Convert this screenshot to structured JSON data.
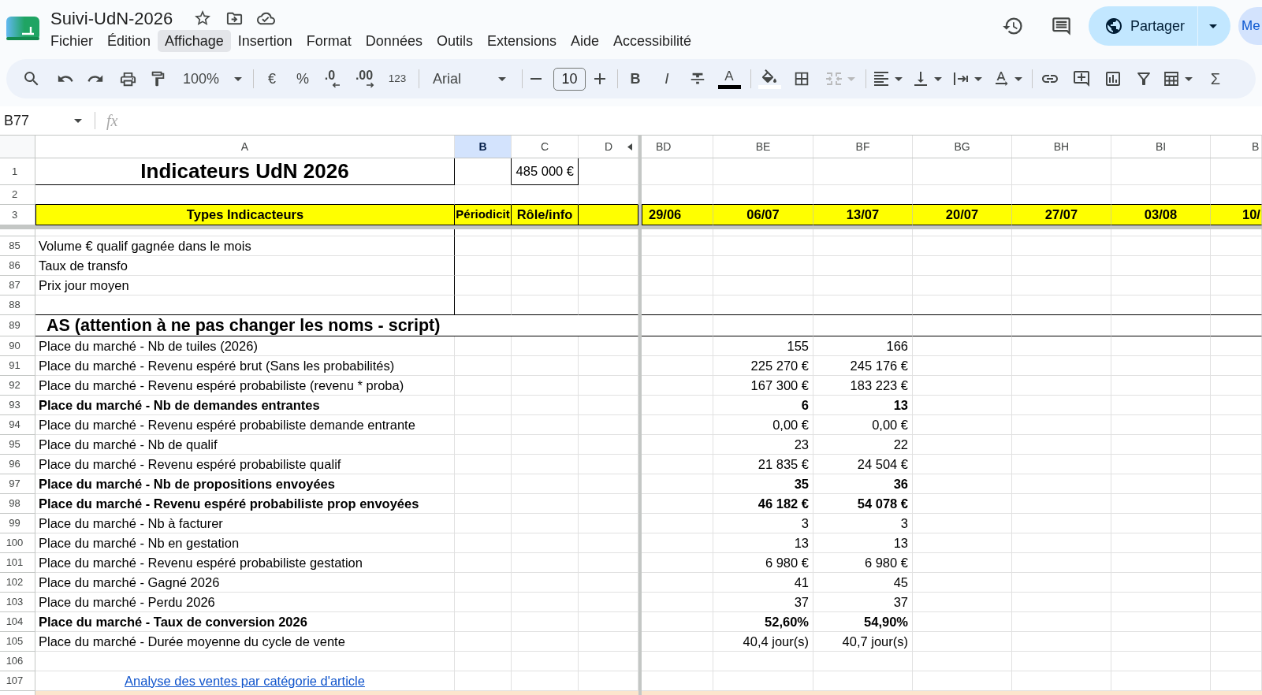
{
  "document": {
    "title": "Suivi-UdN-2026"
  },
  "menu": [
    {
      "label": "Fichier",
      "selected": false
    },
    {
      "label": "Édition",
      "selected": false
    },
    {
      "label": "Affichage",
      "selected": true
    },
    {
      "label": "Insertion",
      "selected": false
    },
    {
      "label": "Format",
      "selected": false
    },
    {
      "label": "Données",
      "selected": false
    },
    {
      "label": "Outils",
      "selected": false
    },
    {
      "label": "Extensions",
      "selected": false
    },
    {
      "label": "Aide",
      "selected": false
    },
    {
      "label": "Accessibilité",
      "selected": false
    }
  ],
  "share": {
    "label": "Partager"
  },
  "account": {
    "label": "Me"
  },
  "toolbar": {
    "zoom": "100%",
    "currency": "€",
    "percent": "%",
    "decrease_decimals": ".0",
    "increase_decimals": ".00",
    "number_format": "123",
    "font": "Arial",
    "font_size": "10",
    "bold": "B",
    "italic": "I",
    "text_color": "A",
    "merge": {
      "disabled": true
    },
    "functions": "Σ"
  },
  "formula_bar": {
    "cell_reference": "B77",
    "fx": "fx"
  },
  "sheet": {
    "frozen_columns": [
      {
        "label": "A",
        "selected": false
      },
      {
        "label": "B",
        "selected": true
      },
      {
        "label": "C",
        "selected": false
      },
      {
        "label": "D",
        "selected": false
      }
    ],
    "scrolled_columns": [
      {
        "label": "BD",
        "selected": false
      },
      {
        "label": "BE",
        "selected": false
      },
      {
        "label": "BF",
        "selected": false
      },
      {
        "label": "BG",
        "selected": false
      },
      {
        "label": "BH",
        "selected": false
      },
      {
        "label": "BI",
        "selected": false
      },
      {
        "label": "B",
        "selected": false
      }
    ],
    "frozen_rows": [
      {
        "number": "1",
        "kind": "title",
        "a": "Indicateurs UdN 2026",
        "c": "485 000 €"
      },
      {
        "number": "2",
        "kind": "blank"
      },
      {
        "number": "3",
        "kind": "header",
        "a": "Types Indicacteurs",
        "b": "Périodicit",
        "c": "Rôle/info",
        "dates": [
          "29/06",
          "06/07",
          "13/07",
          "20/07",
          "27/07",
          "03/08",
          "10/"
        ]
      }
    ],
    "rows": [
      {
        "number": "85",
        "kind": "framed",
        "a": "Volume € qualif gagnée dans le mois",
        "bold": false
      },
      {
        "number": "86",
        "kind": "framed",
        "a": "Taux de transfo",
        "bold": false
      },
      {
        "number": "87",
        "kind": "framed",
        "a": "Prix jour moyen",
        "bold": false
      },
      {
        "number": "88",
        "kind": "framed"
      },
      {
        "number": "89",
        "kind": "section",
        "a": "AS (attention à ne pas changer les noms - script)"
      },
      {
        "number": "90",
        "kind": "item",
        "a": "Place du marché - Nb de tuiles (2026)",
        "bold": false,
        "be": "155",
        "bf": "166"
      },
      {
        "number": "91",
        "kind": "item",
        "a": "Place du marché - Revenu espéré brut (Sans les probabilités)",
        "bold": false,
        "be": "225 270 €",
        "bf": "245 176 €"
      },
      {
        "number": "92",
        "kind": "item",
        "a": "Place du marché - Revenu espéré probabiliste (revenu * proba)",
        "bold": false,
        "be": "167 300 €",
        "bf": "183 223 €"
      },
      {
        "number": "93",
        "kind": "item",
        "a": "Place du marché - Nb de demandes entrantes",
        "bold": true,
        "be": "6",
        "bf": "13"
      },
      {
        "number": "94",
        "kind": "item",
        "a": "Place du marché - Revenu espéré probabiliste demande entrante",
        "bold": false,
        "be": "0,00 €",
        "bf": "0,00 €"
      },
      {
        "number": "95",
        "kind": "item",
        "a": "Place du marché - Nb de qualif",
        "bold": false,
        "be": "23",
        "bf": "22"
      },
      {
        "number": "96",
        "kind": "item",
        "a": "Place du marché - Revenu espéré probabiliste qualif",
        "bold": false,
        "be": "21 835 €",
        "bf": "24 504 €"
      },
      {
        "number": "97",
        "kind": "item",
        "a": "Place du marché - Nb de propositions envoyées",
        "bold": true,
        "be": "35",
        "bf": "36"
      },
      {
        "number": "98",
        "kind": "item",
        "a": "Place du marché - Revenu espéré probabiliste prop envoyées",
        "bold": true,
        "be": "46 182 €",
        "bf": "54 078 €"
      },
      {
        "number": "99",
        "kind": "item",
        "a": "Place du marché - Nb à facturer",
        "bold": false,
        "be": "3",
        "bf": "3"
      },
      {
        "number": "100",
        "kind": "item",
        "a": "Place du marché - Nb en gestation",
        "bold": false,
        "be": "13",
        "bf": "13"
      },
      {
        "number": "101",
        "kind": "item",
        "a": "Place du marché - Revenu espéré probabiliste gestation",
        "bold": false,
        "be": "6 980 €",
        "bf": "6 980 €"
      },
      {
        "number": "102",
        "kind": "item",
        "a": "Place du marché - Gagné 2026",
        "bold": false,
        "be": "41",
        "bf": "45"
      },
      {
        "number": "103",
        "kind": "item",
        "a": "Place du marché - Perdu 2026",
        "bold": false,
        "be": "37",
        "bf": "37"
      },
      {
        "number": "104",
        "kind": "item",
        "a": "Place du marché - Taux de conversion 2026",
        "bold": true,
        "be": "52,60%",
        "bf": "54,90%"
      },
      {
        "number": "105",
        "kind": "item",
        "a": "Place du marché - Durée moyenne du cycle de vente",
        "bold": false,
        "be": "40,4 jour(s)",
        "bf": "40,7 jour(s)"
      },
      {
        "number": "106",
        "kind": "item"
      },
      {
        "number": "107",
        "kind": "link",
        "a": "Analyse des ventes par catégorie d'article"
      },
      {
        "kind": "filled",
        "color": "#fce5cd"
      }
    ]
  }
}
